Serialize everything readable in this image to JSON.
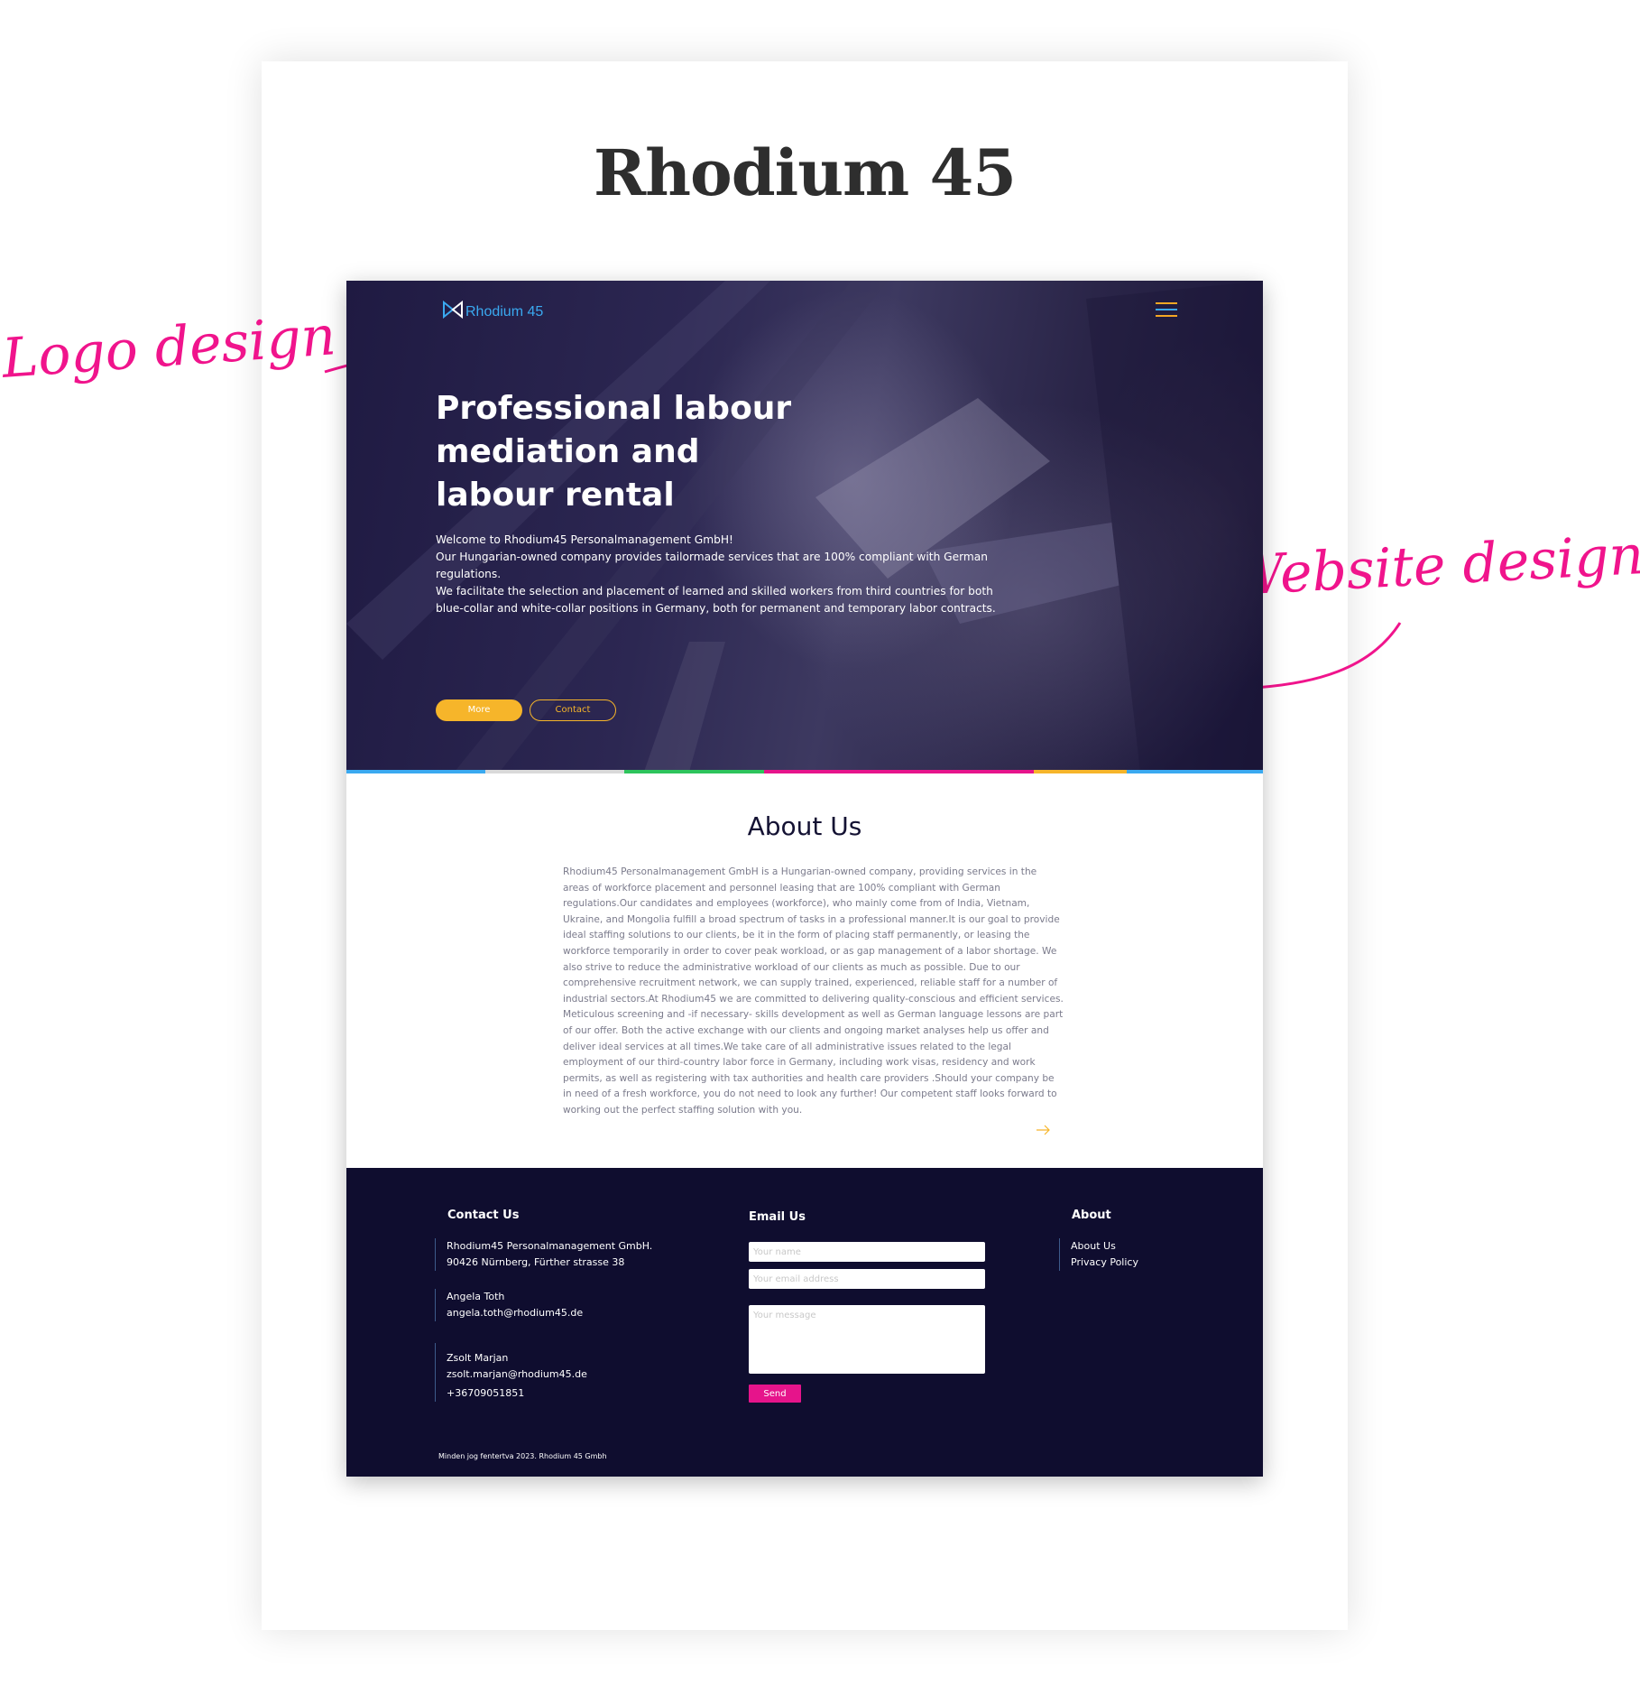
{
  "sheet": {
    "title": "Rhodium 45"
  },
  "annotations": {
    "logo": "Logo design",
    "website": "Website design"
  },
  "colors": {
    "accent_pink": "#f0148c",
    "accent_yellow": "#f6b52a",
    "accent_blue": "#3aa9f0",
    "footer_bg": "#0f0d2f",
    "hero_bg": "#27224a",
    "colorbar": [
      "#3aa9f0",
      "#d9d9d9",
      "#2ec45c",
      "#e6148b",
      "#f6b52a",
      "#3aa9f0"
    ]
  },
  "site": {
    "logo_text": "Rhodium 45",
    "icons": {
      "logo": "logo-mark-icon",
      "menu": "hamburger-menu-icon",
      "arrow": "arrow-right-icon"
    },
    "hero": {
      "title": "Professional labour mediation and labour rental",
      "paragraphs": [
        "Welcome to Rhodium45 Personalmanagement GmbH!",
        "Our Hungarian-owned company provides tailormade services that are 100% compliant with German regulations.",
        "We facilitate the selection and placement of learned and skilled workers from third countries for both blue-collar and white-collar positions in Germany, both for permanent and temporary labor contracts."
      ],
      "more_label": "More",
      "contact_label": "Contact"
    },
    "about": {
      "title": "About Us",
      "text": "Rhodium45 Personalmanagement GmbH is a Hungarian-owned company, providing services in the areas of workforce placement and personnel leasing that are 100% compliant with German regulations.Our candidates and employees (workforce), who mainly come from of India, Vietnam, Ukraine, and Mongolia fulfill a broad spectrum of tasks in a professional manner.It is our goal to provide ideal staffing solutions to our clients, be it in the form of placing staff permanently, or leasing the workforce temporarily in order to cover peak workload, or as gap management of a labor shortage. We also strive to reduce the administrative workload of our clients as much as possible. Due to our comprehensive recruitment network, we can supply trained, experienced, reliable staff for a number of industrial sectors.At Rhodium45 we are committed to delivering quality-conscious and efficient services. Meticulous screening and -if necessary- skills development as well as German language lessons are part of our offer. Both the active exchange with our clients and ongoing market analyses help us offer and deliver ideal services at all times.We take care of all administrative issues related to the legal employment of our third-country labor force in Germany, including work visas, residency and work permits, as well as registering with tax authorities and health care providers .Should your company be in need of a fresh workforce, you do not need to look any further! Our competent staff looks forward to working out the perfect staffing solution with you."
    },
    "footer": {
      "contact": {
        "heading": "Contact Us",
        "company_name": "Rhodium45 Personalmanagement GmbH.",
        "company_address": "90426 Nürnberg, Fürther strasse 38",
        "person1_name": "Angela Toth",
        "person1_email": "angela.toth@rhodium45.de",
        "person2_name": "Zsolt Marjan",
        "person2_email": "zsolt.marjan@rhodium45.de",
        "person2_phone": "+36709051851"
      },
      "email": {
        "heading": "Email Us",
        "name_placeholder": "Your name",
        "email_placeholder": "Your email address",
        "message_placeholder": "Your message",
        "send_label": "Send"
      },
      "about": {
        "heading": "About",
        "links": [
          "About Us",
          "Privacy Policy"
        ]
      },
      "copyright": "Minden jog fentertva 2023. Rhodium 45 Gmbh"
    }
  }
}
